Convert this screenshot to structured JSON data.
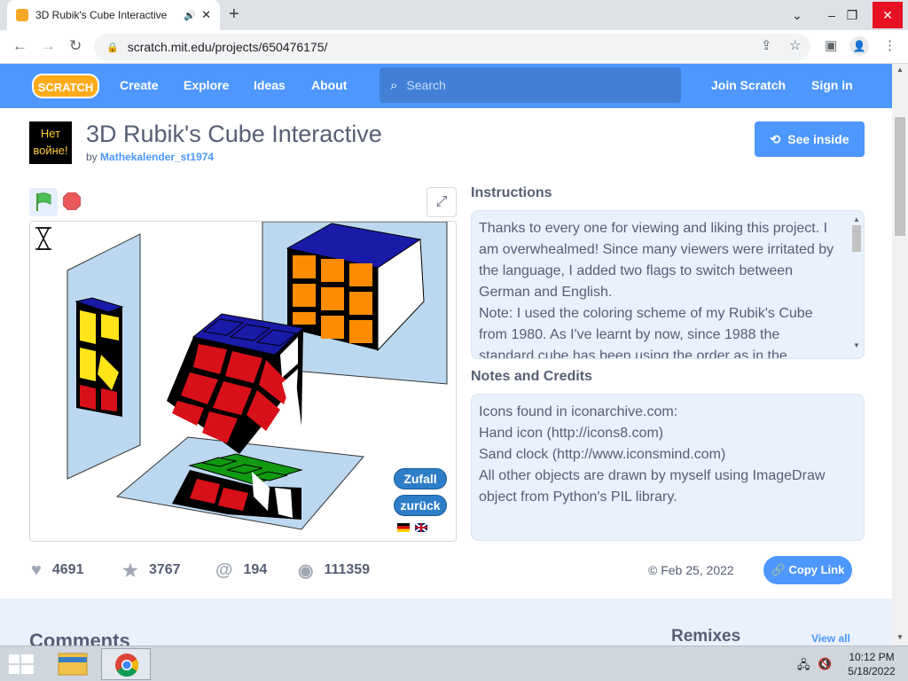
{
  "browser": {
    "tab_title": "3D Rubik's Cube Interactive",
    "url": "scratch.mit.edu/projects/650476175/",
    "new_tab": "+",
    "win_min": "⌄",
    "win_restore": "–",
    "win_max": "❐",
    "win_close": "✕"
  },
  "nav": {
    "logo": "SCRATCH",
    "links": [
      "Create",
      "Explore",
      "Ideas",
      "About"
    ],
    "search_placeholder": "Search",
    "join": "Join Scratch",
    "signin": "Sign in"
  },
  "project": {
    "avatar_line1": "Нет",
    "avatar_line2": "войне!",
    "title": "3D Rubik's Cube Interactive",
    "by": "by",
    "author": "Mathekalender_st1974",
    "see_inside": "See inside",
    "stage_buttons": [
      "Zufall",
      "zurück"
    ]
  },
  "instructions": {
    "heading": "Instructions",
    "paragraphs": [
      "Thanks to every one for viewing and liking this project. I am overwhealmed! Since many viewers were irritated by the language, I added two flags to switch between German and English.",
      "Note: I used the coloring scheme of my Rubik's Cube from 1980. As I've learnt by now, since 1988 the standard cube has been using the order as in the mirrored cubes."
    ]
  },
  "notes": {
    "heading": "Notes and Credits",
    "lines": [
      "Icons found in iconarchive.com:",
      "Hand icon (http://icons8.com)",
      "Sand clock (http://www.iconsmind.com)",
      "All other objects are drawn by myself using ImageDraw object from Python's PIL library."
    ]
  },
  "stats": {
    "loves": "4691",
    "favorites": "3767",
    "remixes": "194",
    "views": "111359",
    "date": "© Feb 25, 2022",
    "copy_link": "Copy Link"
  },
  "bottom": {
    "comments": "Comments",
    "remixes": "Remixes",
    "view_all": "View all"
  },
  "taskbar": {
    "time": "10:12 PM",
    "date": "5/18/2022"
  },
  "colors": {
    "scratch_blue": "#4d97ff",
    "cube_red": "#d8101a",
    "cube_orange": "#ff8c00",
    "cube_blue": "#1515a8",
    "cube_yellow": "#ffe51a",
    "cube_green": "#119a11"
  }
}
